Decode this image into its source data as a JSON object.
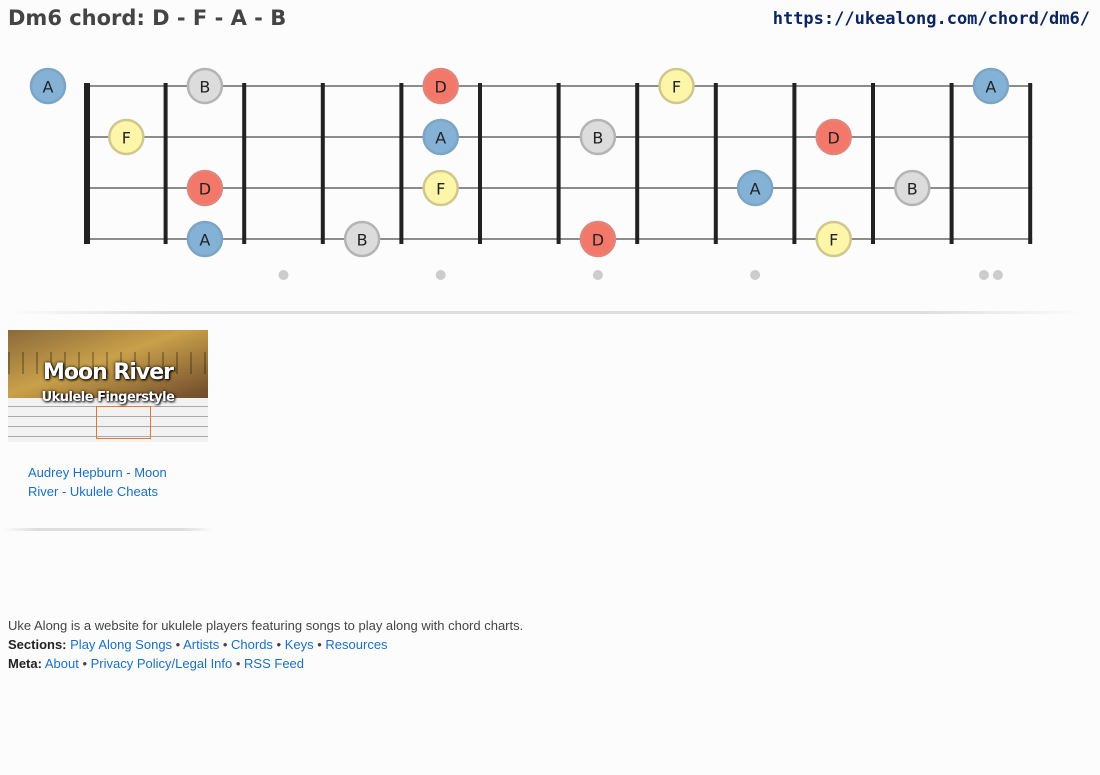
{
  "header": {
    "title": "Dm6 chord: D - F - A - B",
    "url": "https://ukealong.com/chord/dm6/"
  },
  "colors": {
    "D": "#f4786a",
    "F": "#fdf6a8",
    "A": "#84b1d6",
    "B": "#dcdcdc",
    "D_border": "#e0857a",
    "F_border": "#cfc78e",
    "A_border": "#7ea4c4",
    "B_border": "#b4b4b4",
    "fret": "#222222",
    "string": "#666666",
    "inlay": "#cccccc"
  },
  "fretboard": {
    "strings": 4,
    "frets": 12,
    "fret_markers": [
      3,
      5,
      7,
      9,
      12
    ],
    "notes": [
      {
        "string": 1,
        "fret": 0,
        "note": "A"
      },
      {
        "string": 1,
        "fret": 2,
        "note": "B"
      },
      {
        "string": 1,
        "fret": 5,
        "note": "D"
      },
      {
        "string": 1,
        "fret": 8,
        "note": "F"
      },
      {
        "string": 1,
        "fret": 12,
        "note": "A"
      },
      {
        "string": 2,
        "fret": 1,
        "note": "F"
      },
      {
        "string": 2,
        "fret": 5,
        "note": "A"
      },
      {
        "string": 2,
        "fret": 7,
        "note": "B"
      },
      {
        "string": 2,
        "fret": 10,
        "note": "D"
      },
      {
        "string": 3,
        "fret": 2,
        "note": "D"
      },
      {
        "string": 3,
        "fret": 5,
        "note": "F"
      },
      {
        "string": 3,
        "fret": 9,
        "note": "A"
      },
      {
        "string": 3,
        "fret": 11,
        "note": "B"
      },
      {
        "string": 4,
        "fret": 2,
        "note": "A"
      },
      {
        "string": 4,
        "fret": 4,
        "note": "B"
      },
      {
        "string": 4,
        "fret": 7,
        "note": "D"
      },
      {
        "string": 4,
        "fret": 10,
        "note": "F"
      }
    ]
  },
  "card": {
    "thumb_title": "Moon River",
    "thumb_subtitle": "Ukulele Fingerstyle",
    "link_text": "Audrey Hepburn - Moon River - Ukulele Cheats"
  },
  "footer": {
    "description": "Uke Along is a website for ukulele players featuring songs to play along with chord charts.",
    "sections_label": "Sections:",
    "sections": [
      "Play Along Songs",
      "Artists",
      "Chords",
      "Keys",
      "Resources"
    ],
    "meta_label": "Meta:",
    "meta": [
      "About",
      "Privacy Policy/Legal Info",
      "RSS Feed"
    ],
    "separator": "•"
  }
}
